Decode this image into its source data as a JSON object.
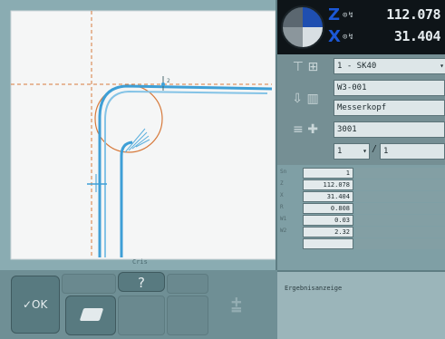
{
  "coordinates": {
    "z": {
      "letter": "Z",
      "symbols": "⊙↯",
      "value": "112.078"
    },
    "x": {
      "letter": "X",
      "symbols": "⊙↯",
      "value": "31.404"
    }
  },
  "tool": {
    "selected": "1 - SK40",
    "id": "W3-001",
    "name": "Messerkopf",
    "number": "3001",
    "edge_current": "1",
    "edge_total": "1"
  },
  "values": [
    {
      "label": "Sn",
      "value": "1"
    },
    {
      "label": "Z",
      "value": "112.078"
    },
    {
      "label": "X",
      "value": "31.404"
    },
    {
      "label": "R",
      "value": "0.808"
    },
    {
      "label": "W1",
      "value": "0.03"
    },
    {
      "label": "W2",
      "value": "2.32"
    }
  ],
  "graphic": {
    "caption": "Cris",
    "marker": "2"
  },
  "softkeys": {
    "ok": "✓OK",
    "help": "?"
  },
  "result": {
    "title": "Ergebnisanzeige"
  },
  "colors": {
    "axis_accent": "#1c58d6",
    "crosshair": "#d77a3c",
    "profile": "#3e9fd6",
    "plot_background": "#f7f7f7"
  }
}
